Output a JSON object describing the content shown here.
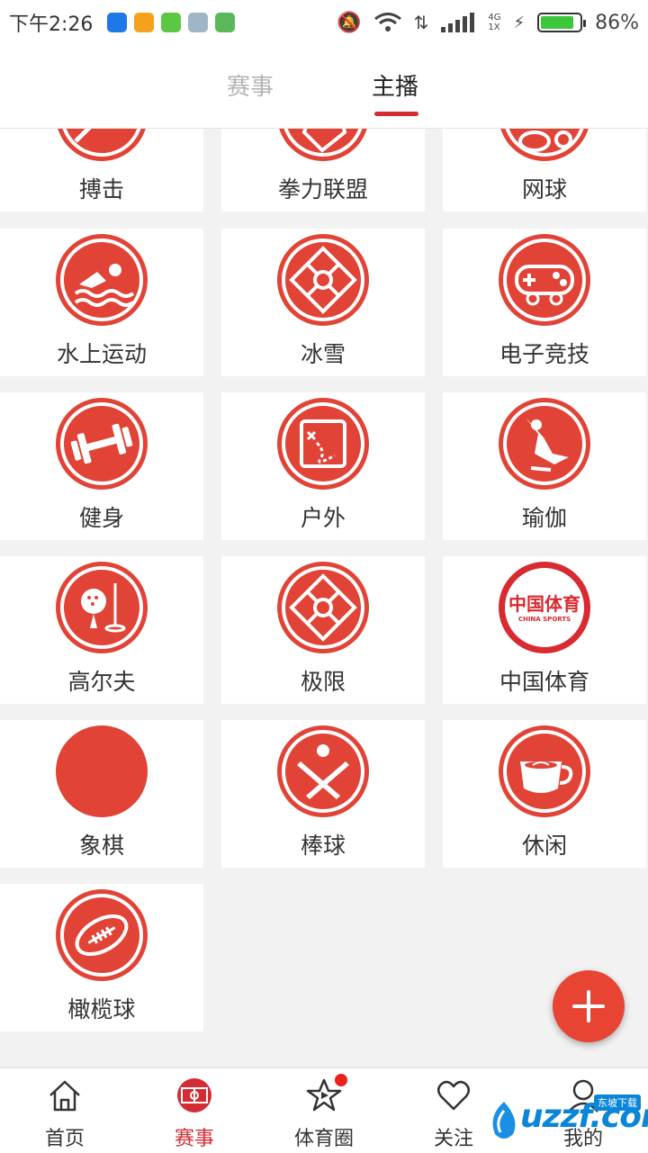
{
  "status_bar": {
    "time": "下午2:26",
    "network": "4G\n1X",
    "battery": "86%",
    "battery_level": 0.86
  },
  "tabs": [
    {
      "label": "赛事",
      "active": false
    },
    {
      "label": "主播",
      "active": true
    }
  ],
  "categories": [
    {
      "label": "搏击",
      "icon": "fighting-icon"
    },
    {
      "label": "拳力联盟",
      "icon": "boxing-glove-icon"
    },
    {
      "label": "网球",
      "icon": "tennis-icon"
    },
    {
      "label": "水上运动",
      "icon": "swimmer-icon"
    },
    {
      "label": "冰雪",
      "icon": "snowflake-diamond-icon"
    },
    {
      "label": "电子竞技",
      "icon": "gamepad-icon"
    },
    {
      "label": "健身",
      "icon": "dumbbell-icon"
    },
    {
      "label": "户外",
      "icon": "map-icon"
    },
    {
      "label": "瑜伽",
      "icon": "yoga-icon"
    },
    {
      "label": "高尔夫",
      "icon": "golf-icon"
    },
    {
      "label": "极限",
      "icon": "extreme-diamond-icon"
    },
    {
      "label": "中国体育",
      "icon": "china-sports-logo",
      "logo_text": "中国体育",
      "logo_subtext": "CHINA SPORTS"
    },
    {
      "label": "象棋",
      "icon": "chess-icon"
    },
    {
      "label": "棒球",
      "icon": "baseball-icon"
    },
    {
      "label": "休闲",
      "icon": "coffee-cup-icon"
    },
    {
      "label": "橄榄球",
      "icon": "rugby-ball-icon"
    }
  ],
  "bottom_nav": [
    {
      "label": "首页",
      "icon": "home-icon",
      "active": false
    },
    {
      "label": "赛事",
      "icon": "field-icon",
      "active": true
    },
    {
      "label": "体育圈",
      "icon": "star-play-icon",
      "active": false,
      "badge_dot": true
    },
    {
      "label": "关注",
      "icon": "heart-icon",
      "active": false
    },
    {
      "label": "我的",
      "icon": "user-icon",
      "active": false
    }
  ],
  "watermark": {
    "text": "uzzf.com",
    "badge": "东坡下载"
  },
  "colors": {
    "accent": "#d32c35",
    "icon_bg": "#e14336",
    "page_bg": "#f2f2f2"
  }
}
